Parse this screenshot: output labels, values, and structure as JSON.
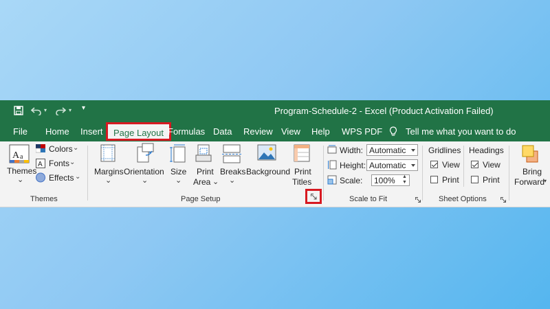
{
  "window": {
    "title": "Program-Schedule-2  -  Excel (Product Activation Failed)"
  },
  "quick_access": {
    "customize_glyph": "▾"
  },
  "tabs": [
    {
      "label": "File"
    },
    {
      "label": "Home"
    },
    {
      "label": "Insert"
    },
    {
      "label": "Page Layout",
      "active": true
    },
    {
      "label": "Formulas"
    },
    {
      "label": "Data"
    },
    {
      "label": "Review"
    },
    {
      "label": "View"
    },
    {
      "label": "Help"
    },
    {
      "label": "WPS PDF"
    }
  ],
  "tell_me": {
    "label": "Tell me what you want to do",
    "icon": "lightbulb-icon"
  },
  "themes_group": {
    "label": "Themes",
    "themes_button": "Themes",
    "colors": "Colors",
    "fonts": "Fonts",
    "effects": "Effects",
    "dropdown_glyph": "⌄"
  },
  "page_setup": {
    "label": "Page Setup",
    "margins": "Margins",
    "orientation": "Orientation",
    "size": "Size",
    "print_area_1": "Print",
    "print_area_2": "Area",
    "breaks": "Breaks",
    "background": "Background",
    "print_titles_1": "Print",
    "print_titles_2": "Titles",
    "dropdown_glyph": "⌄"
  },
  "scale_to_fit": {
    "label": "Scale to Fit",
    "width_label": "Width:",
    "width_value": "Automatic",
    "height_label": "Height:",
    "height_value": "Automatic",
    "scale_label": "Scale:",
    "scale_value": "100%"
  },
  "sheet_options": {
    "label": "Sheet Options",
    "gridlines": "Gridlines",
    "headings": "Headings",
    "view": "View",
    "print": "Print",
    "gridlines_view_checked": true,
    "gridlines_print_checked": false,
    "headings_view_checked": true,
    "headings_print_checked": false
  },
  "arrange": {
    "bring_forward_1": "Bring",
    "bring_forward_2": "Forward"
  },
  "colors": {
    "excel_green": "#217346",
    "highlight_red": "#d71921",
    "ribbon_bg": "#f3f3f3"
  }
}
